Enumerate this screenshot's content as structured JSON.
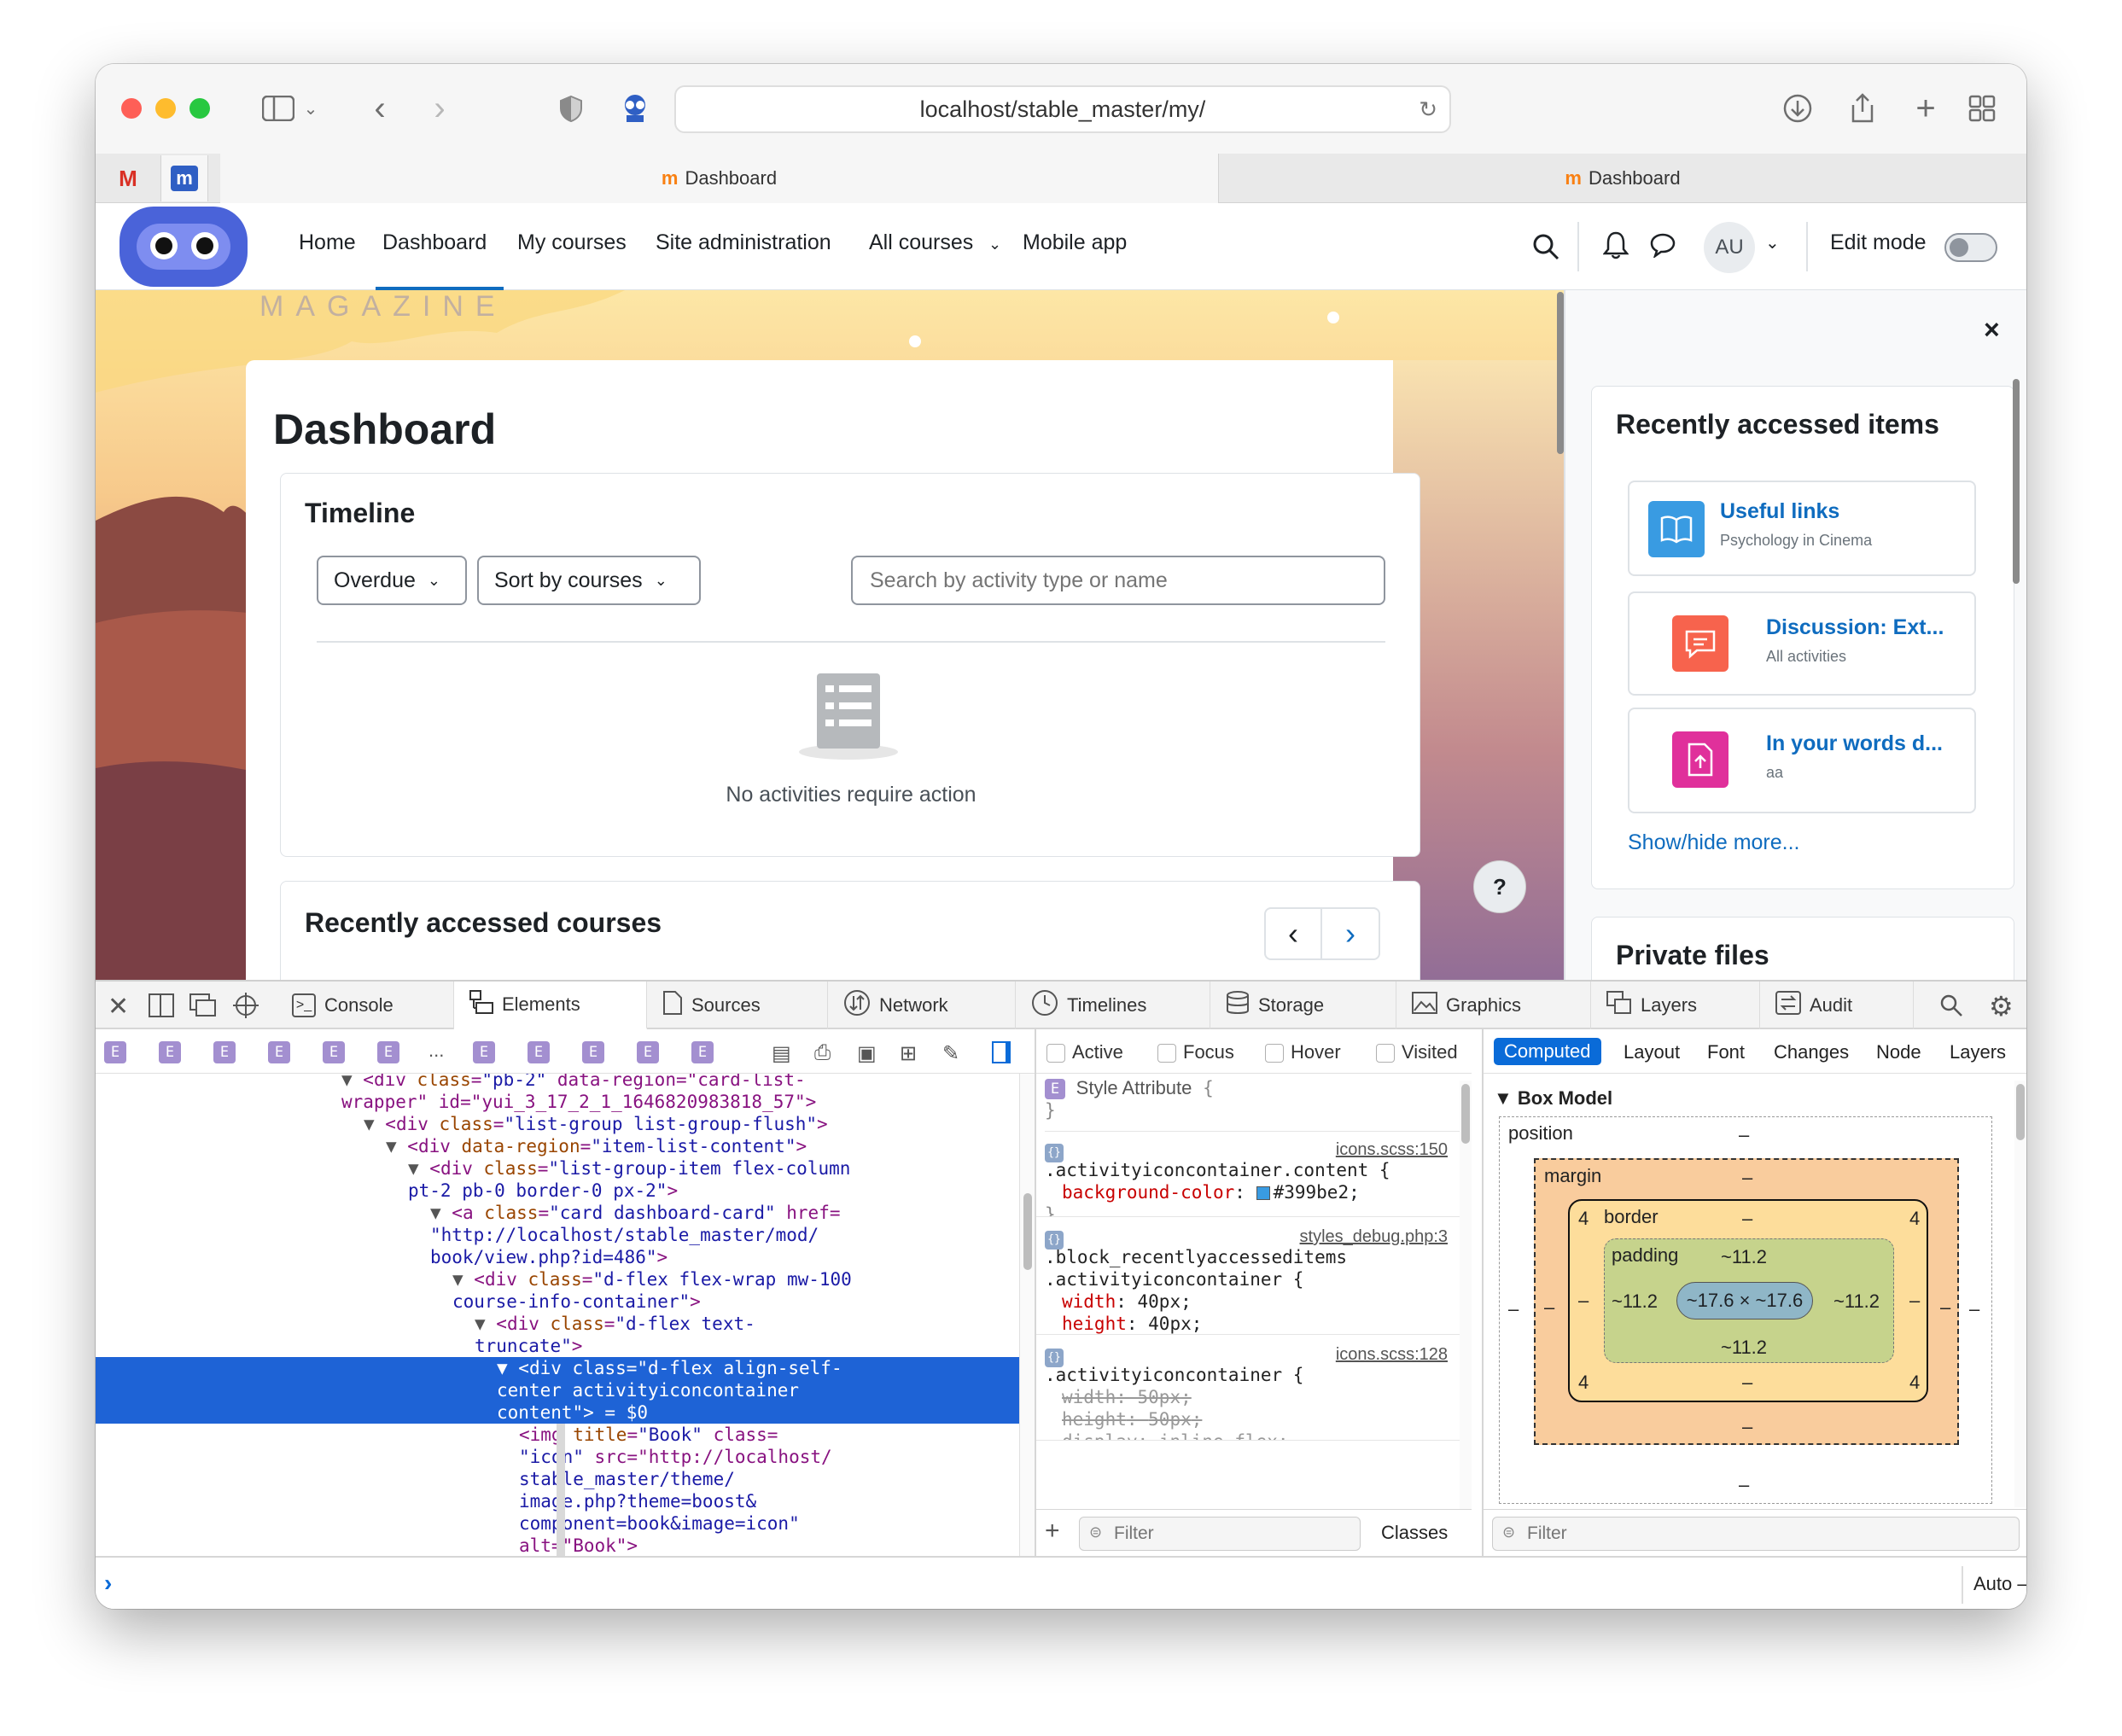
{
  "browser": {
    "url": "localhost/stable_master/my/",
    "tabs": [
      {
        "label": "Dashboard"
      },
      {
        "label": "Dashboard"
      }
    ]
  },
  "site": {
    "logo_text": "MAGAZINE",
    "nav": [
      "Home",
      "Dashboard",
      "My courses",
      "Site administration",
      "All courses",
      "Mobile app"
    ],
    "user_initials": "AU",
    "edit_mode_label": "Edit mode",
    "page_title": "Dashboard",
    "timeline": {
      "title": "Timeline",
      "filter": "Overdue",
      "sort": "Sort by courses",
      "search_placeholder": "Search by activity type or name",
      "empty": "No activities require action"
    },
    "recent_courses_title": "Recently accessed courses",
    "help_label": "?"
  },
  "drawer": {
    "close": "×",
    "recent_title": "Recently accessed items",
    "items": [
      {
        "title": "Useful links",
        "sub": "Psychology in Cinema",
        "color": "#399be2"
      },
      {
        "title": "Discussion: Ext...",
        "sub": "All activities",
        "color": "#f7634d"
      },
      {
        "title": "In your words d...",
        "sub": "aa",
        "color": "#eb66a2"
      }
    ],
    "show_more": "Show/hide more...",
    "private_files": "Private files"
  },
  "devtools": {
    "tabs": [
      "Console",
      "Elements",
      "Sources",
      "Network",
      "Timelines",
      "Storage",
      "Graphics",
      "Layers",
      "Audit"
    ],
    "crumb_letter": "E",
    "crumb_ellipsis": "...",
    "dom": [
      {
        "ind": 13,
        "arrow": "▼",
        "tag": "<div ",
        "attr": "class",
        "val": "\"pb-2\"",
        "rest": " data-region=\"card-list-"
      },
      {
        "ind": 13,
        "arrow": "",
        "tag": "wrapper\" id=\"yui_3_17_2_1_1646820983818_57\">",
        "attr": "",
        "val": "",
        "rest": ""
      },
      {
        "ind": 14,
        "arrow": "▼",
        "tag": "<div ",
        "attr": "class",
        "val": "\"list-group list-group-flush\"",
        "rest": ">"
      },
      {
        "ind": 15,
        "arrow": "▼",
        "tag": "<div ",
        "attr": "data-region",
        "val": "\"item-list-content\"",
        "rest": ">"
      },
      {
        "ind": 16,
        "arrow": "▼",
        "tag": "<div ",
        "attr": "class",
        "val": "\"list-group-item flex-column",
        "rest": ""
      },
      {
        "ind": 16,
        "arrow": "",
        "tag": "",
        "attr": "",
        "val": "pt-2 pb-0 border-0 px-2\"",
        "rest": ">"
      },
      {
        "ind": 17,
        "arrow": "▼",
        "tag": "<a ",
        "attr": "class",
        "val": "\"card dashboard-card\"",
        "rest": " href="
      },
      {
        "ind": 17,
        "arrow": "",
        "tag": "",
        "attr": "",
        "val": "\"http://localhost/stable_master/mod/",
        "rest": ""
      },
      {
        "ind": 17,
        "arrow": "",
        "tag": "",
        "attr": "",
        "val": "book/view.php?id=486\"",
        "rest": ">"
      },
      {
        "ind": 18,
        "arrow": "▼",
        "tag": "<div ",
        "attr": "class",
        "val": "\"d-flex flex-wrap mw-100",
        "rest": ""
      },
      {
        "ind": 18,
        "arrow": "",
        "tag": "",
        "attr": "",
        "val": "course-info-container\"",
        "rest": ">"
      },
      {
        "ind": 19,
        "arrow": "▼",
        "tag": "<div ",
        "attr": "class",
        "val": "\"d-flex text-",
        "rest": ""
      },
      {
        "ind": 19,
        "arrow": "",
        "tag": "",
        "attr": "",
        "val": "truncate\"",
        "rest": ">"
      },
      {
        "ind": 20,
        "arrow": "▼",
        "tag": "<div class=\"d-flex align-self-",
        "attr": "",
        "val": "",
        "rest": "",
        "sel": true
      },
      {
        "ind": 20,
        "arrow": "",
        "tag": "center activityiconcontainer",
        "attr": "",
        "val": "",
        "rest": "",
        "sel": true
      },
      {
        "ind": 20,
        "arrow": "",
        "tag": "content\"> = $0",
        "attr": "",
        "val": "",
        "rest": "",
        "sel": true
      },
      {
        "ind": 21,
        "arrow": "",
        "tag": "<img ",
        "attr": "title",
        "val": "\"Book\"",
        "rest": " class="
      },
      {
        "ind": 21,
        "arrow": "",
        "tag": "",
        "attr": "",
        "val": "\"icon\"",
        "rest": " src=\"http://localhost/"
      },
      {
        "ind": 21,
        "arrow": "",
        "tag": "",
        "attr": "",
        "val": "stable_master/theme/",
        "rest": ""
      },
      {
        "ind": 21,
        "arrow": "",
        "tag": "",
        "attr": "",
        "val": "image.php?theme=boost&",
        "rest": ""
      },
      {
        "ind": 21,
        "arrow": "",
        "tag": "",
        "attr": "",
        "val": "component=book&image=icon\"",
        "rest": ""
      },
      {
        "ind": 21,
        "arrow": "",
        "tag": "alt=\"Book\">",
        "attr": "",
        "val": "",
        "rest": ""
      }
    ],
    "states": [
      "Active",
      "Focus",
      "Hover",
      "Visited"
    ],
    "style_attr": "Style Attribute",
    "rules": [
      {
        "source": "icons.scss:150",
        "selector": ".activityiconcontainer.content",
        "props": [
          {
            "k": "background-color",
            "v": "#399be2",
            "swatch": "#399be2"
          }
        ]
      },
      {
        "source": "styles_debug.php:3",
        "selector": ".block_recentlyaccesseditems .activityiconcontainer",
        "props": [
          {
            "k": "width",
            "v": "40px"
          },
          {
            "k": "height",
            "v": "40px"
          }
        ]
      },
      {
        "source": "icons.scss:128",
        "selector": ".activityiconcontainer",
        "props": [
          {
            "k": "width",
            "v": "50px",
            "strike": true
          },
          {
            "k": "height",
            "v": "50px",
            "strike": true
          },
          {
            "k": "display",
            "v": "inline-flex",
            "strike": true
          }
        ]
      }
    ],
    "filter_placeholder": "Filter",
    "classes_label": "Classes",
    "sidebar_tabs": [
      "Computed",
      "Layout",
      "Font",
      "Changes",
      "Node",
      "Layers"
    ],
    "box_model": {
      "title": "Box Model",
      "position": "position",
      "margin": "margin",
      "border": "border",
      "padding": "padding",
      "dash": "–",
      "border_val": "4",
      "padding_val": "~11.2",
      "content": "~17.6 × ~17.6"
    },
    "console_context": "Auto — my"
  }
}
